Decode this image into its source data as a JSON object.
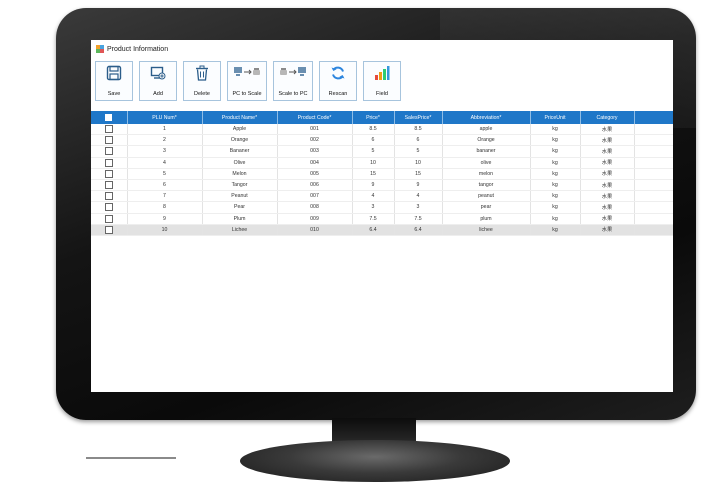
{
  "window": {
    "title": "Product Information"
  },
  "toolbar": {
    "buttons": [
      {
        "label": "Save",
        "icon": "save-icon"
      },
      {
        "label": "Add",
        "icon": "add-icon"
      },
      {
        "label": "Delete",
        "icon": "trash-icon"
      },
      {
        "label": "PC to Scale",
        "icon": "pc-to-scale-icon"
      },
      {
        "label": "Scale to PC",
        "icon": "scale-to-pc-icon"
      },
      {
        "label": "Rescan",
        "icon": "refresh-icon"
      },
      {
        "label": "Field",
        "icon": "bar-chart-icon"
      }
    ]
  },
  "table": {
    "columns": [
      "PLU Num*",
      "Product Name*",
      "Product Code*",
      "Price*",
      "SalesPrice*",
      "Abbreviation*",
      "PriceUnit",
      "Category"
    ],
    "rows": [
      [
        "1",
        "Apple",
        "001",
        "8.5",
        "8.5",
        "apple",
        "kg",
        "水果"
      ],
      [
        "2",
        "Orange",
        "002",
        "6",
        "6",
        "Orange",
        "kg",
        "水果"
      ],
      [
        "3",
        "Bananer",
        "003",
        "5",
        "5",
        "bananer",
        "kg",
        "水果"
      ],
      [
        "4",
        "Olive",
        "004",
        "10",
        "10",
        "olive",
        "kg",
        "水果"
      ],
      [
        "5",
        "Melon",
        "005",
        "15",
        "15",
        "melon",
        "kg",
        "水果"
      ],
      [
        "6",
        "Tangor",
        "006",
        "9",
        "9",
        "tangor",
        "kg",
        "水果"
      ],
      [
        "7",
        "Peanut",
        "007",
        "4",
        "4",
        "peanut",
        "kg",
        "水果"
      ],
      [
        "8",
        "Pear",
        "008",
        "3",
        "3",
        "pear",
        "kg",
        "水果"
      ],
      [
        "9",
        "Plum",
        "009",
        "7.5",
        "7.5",
        "plum",
        "kg",
        "水果"
      ],
      [
        "10",
        "Lichee",
        "010",
        "6.4",
        "6.4",
        "lichee",
        "kg",
        "水果"
      ]
    ],
    "selected_row": 9
  },
  "colors": {
    "header": "#1f77c8",
    "bezel": "#111111",
    "accent": "#2e86de"
  }
}
